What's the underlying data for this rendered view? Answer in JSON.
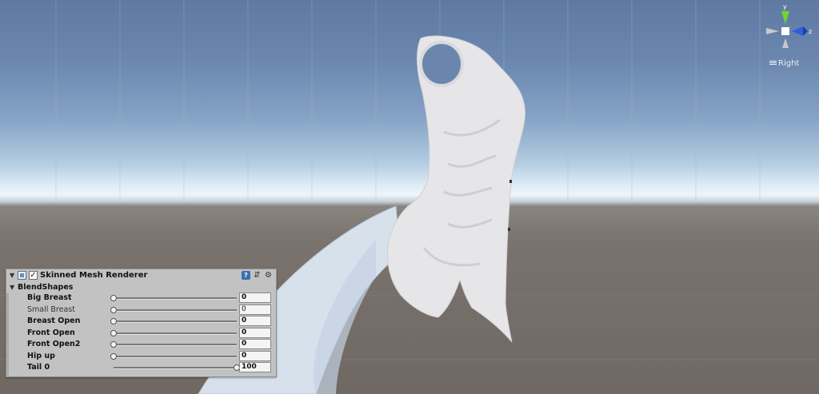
{
  "scene": {
    "orientation_label": "Right",
    "axis_y_label": "y",
    "axis_z_label": "z",
    "colors": {
      "sky_top": "#5e7aa3",
      "horizon": "#eef6fb",
      "ground": "#6f6863",
      "axis_y": "#6fd62c",
      "axis_z": "#2f5fe0",
      "model": "#e6e6e9"
    }
  },
  "component": {
    "title": "Skinned Mesh Renderer",
    "enabled": true,
    "icons": [
      "help-icon",
      "preset-icon",
      "settings-gear-icon"
    ],
    "blendshapes_label": "BlendShapes",
    "blendshapes": [
      {
        "label": "Big Breast",
        "value": "0",
        "fraction": 0,
        "bold": true
      },
      {
        "label": "Small Breast",
        "value": "0",
        "fraction": 0,
        "bold": false
      },
      {
        "label": "Breast Open",
        "value": "0",
        "fraction": 0,
        "bold": true
      },
      {
        "label": "Front Open",
        "value": "0",
        "fraction": 0,
        "bold": true
      },
      {
        "label": "Front Open2",
        "value": "0",
        "fraction": 0,
        "bold": true
      },
      {
        "label": "Hip up",
        "value": "0",
        "fraction": 0,
        "bold": true
      },
      {
        "label": "Tail 0",
        "value": "100",
        "fraction": 1,
        "bold": true
      }
    ]
  }
}
